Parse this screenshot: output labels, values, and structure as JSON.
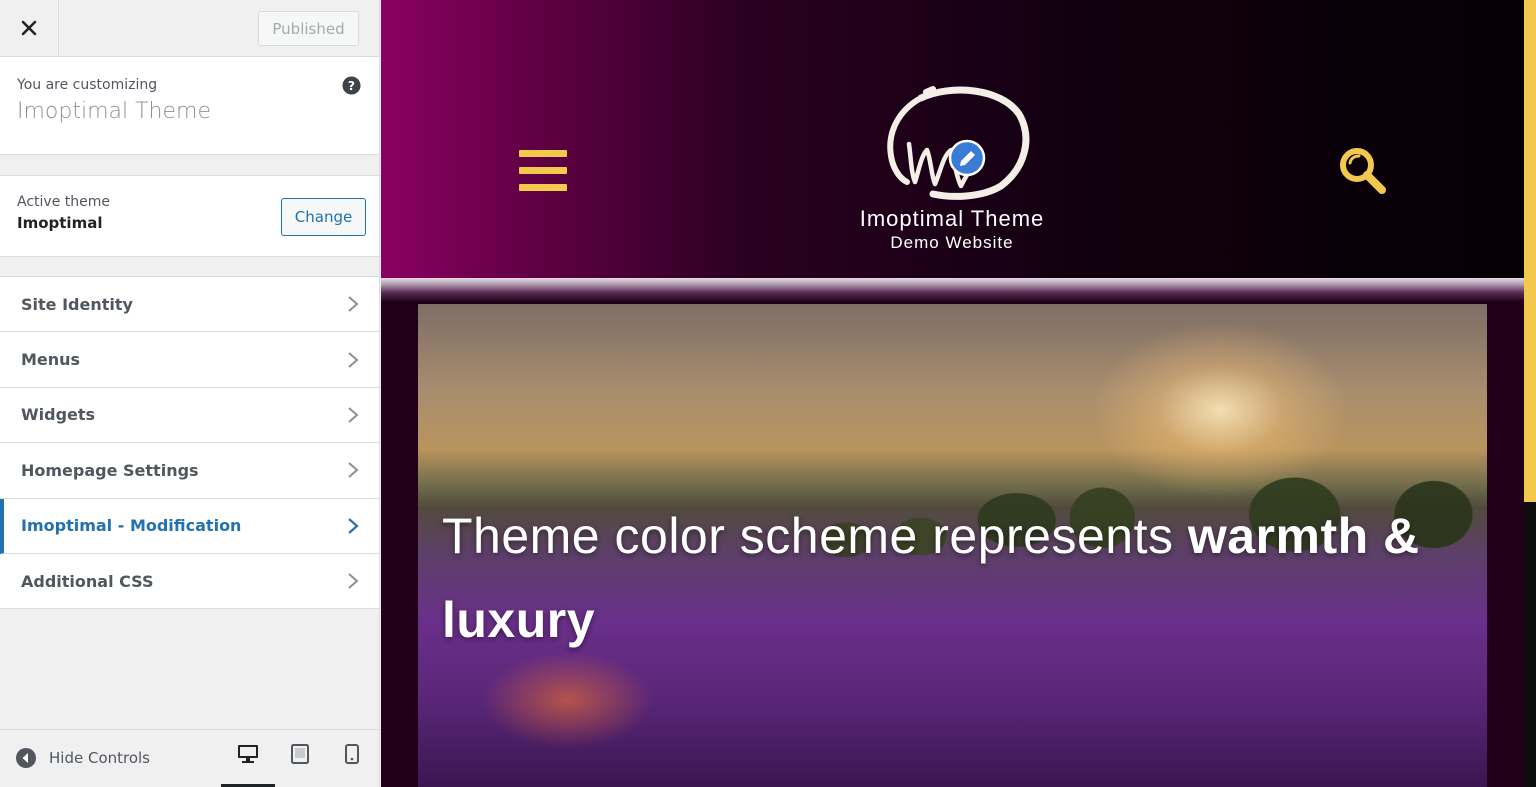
{
  "sidebar": {
    "top_bar": {
      "publish_label": "Published",
      "close_icon": "close-icon"
    },
    "customizing": {
      "label": "You are customizing",
      "theme_name": "Imoptimal Theme",
      "help_icon": "help-icon"
    },
    "active_theme": {
      "label": "Active theme",
      "name": "Imoptimal",
      "change_label": "Change"
    },
    "items": [
      {
        "label": "Site Identity",
        "active": false
      },
      {
        "label": "Menus",
        "active": false
      },
      {
        "label": "Widgets",
        "active": false
      },
      {
        "label": "Homepage Settings",
        "active": false
      },
      {
        "label": "Imoptimal - Modification",
        "active": true
      },
      {
        "label": "Additional CSS",
        "active": false
      }
    ],
    "footer": {
      "hide_label": "Hide Controls",
      "devices": [
        "desktop-icon",
        "tablet-icon",
        "mobile-icon"
      ],
      "active_device": "desktop"
    }
  },
  "preview": {
    "site_title": "Imoptimal Theme",
    "tagline": "Demo Website",
    "hero": {
      "text_regular": "Theme color scheme represents ",
      "text_bold": "warmth & luxury"
    }
  },
  "colors": {
    "accent": "#2271b1",
    "yellow": "#f2c94c",
    "header_left": "#8a0060",
    "header_right": "#050004"
  }
}
